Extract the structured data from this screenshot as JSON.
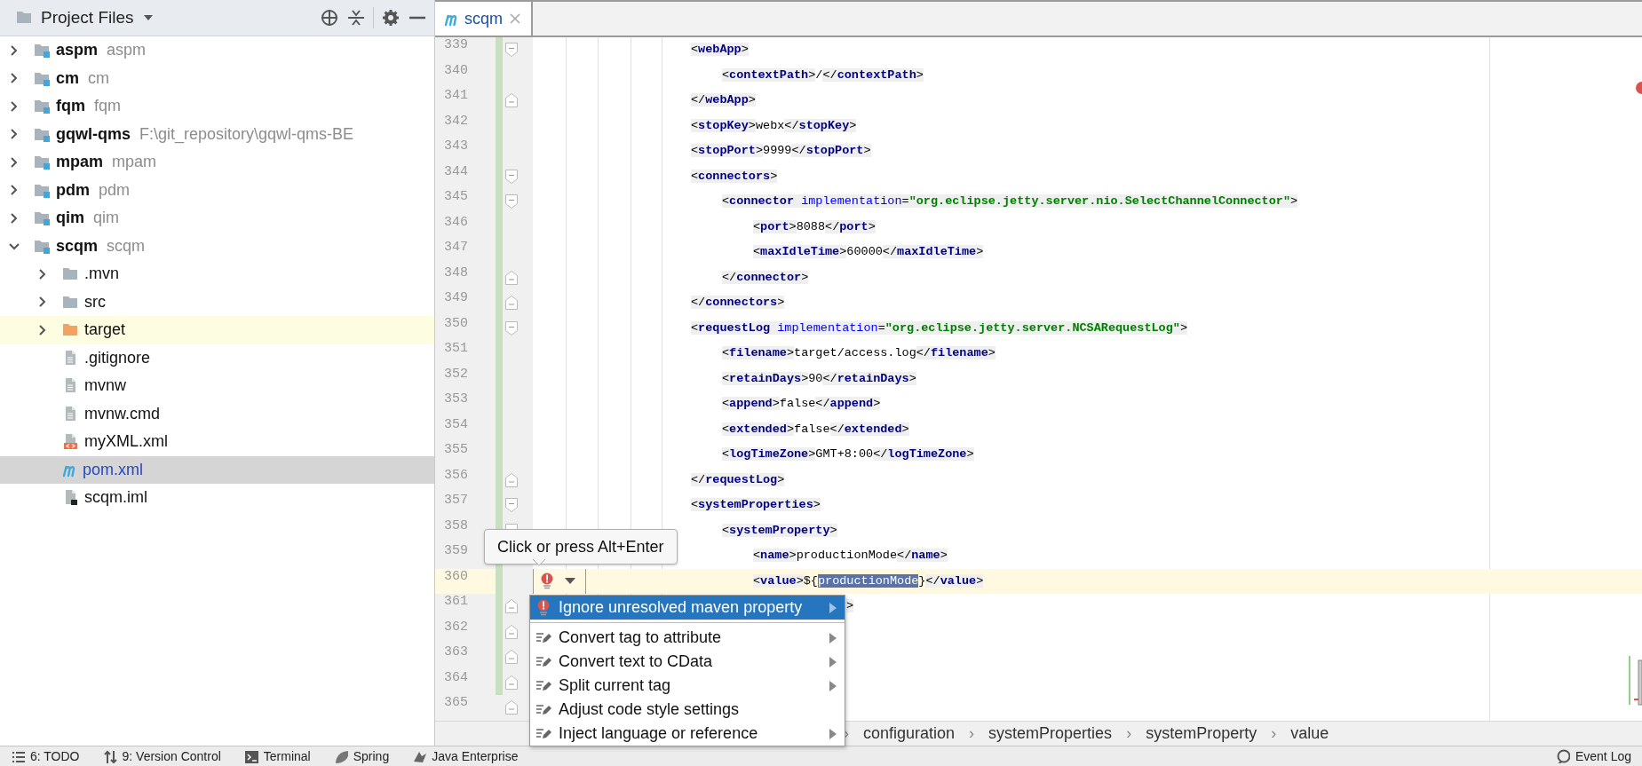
{
  "sidebar": {
    "title": "Project Files",
    "items": [
      {
        "label": "aspm",
        "hint": "aspm",
        "kind": "module",
        "expanded": false,
        "selected": false,
        "highlighted": false,
        "modified": false
      },
      {
        "label": "cm",
        "hint": "cm",
        "kind": "module",
        "expanded": false,
        "selected": false,
        "highlighted": false,
        "modified": false
      },
      {
        "label": "fqm",
        "hint": "fqm",
        "kind": "module",
        "expanded": false,
        "selected": false,
        "highlighted": false,
        "modified": false
      },
      {
        "label": "gqwl-qms",
        "hint": "F:\\git_repository\\gqwl-qms-BE",
        "kind": "module",
        "expanded": false,
        "selected": false,
        "highlighted": false,
        "modified": false
      },
      {
        "label": "mpam",
        "hint": "mpam",
        "kind": "module",
        "expanded": false,
        "selected": false,
        "highlighted": false,
        "modified": false
      },
      {
        "label": "pdm",
        "hint": "pdm",
        "kind": "module",
        "expanded": false,
        "selected": false,
        "highlighted": false,
        "modified": false
      },
      {
        "label": "qim",
        "hint": "qim",
        "kind": "module",
        "expanded": false,
        "selected": false,
        "highlighted": false,
        "modified": false
      },
      {
        "label": "scqm",
        "hint": "scqm",
        "kind": "module",
        "expanded": true,
        "selected": false,
        "highlighted": false,
        "modified": false,
        "children": [
          {
            "label": ".mvn",
            "kind": "folder",
            "expanded": false,
            "selected": false,
            "highlighted": false,
            "modified": false
          },
          {
            "label": "src",
            "kind": "folder",
            "expanded": false,
            "selected": false,
            "highlighted": false,
            "modified": false
          },
          {
            "label": "target",
            "kind": "excluded",
            "expanded": false,
            "selected": false,
            "highlighted": true,
            "modified": false
          },
          {
            "label": ".gitignore",
            "kind": "file",
            "selected": false,
            "highlighted": false,
            "modified": false
          },
          {
            "label": "mvnw",
            "kind": "file",
            "selected": false,
            "highlighted": false,
            "modified": false
          },
          {
            "label": "mvnw.cmd",
            "kind": "file",
            "selected": false,
            "highlighted": false,
            "modified": false
          },
          {
            "label": "myXML.xml",
            "kind": "xml",
            "selected": false,
            "highlighted": false,
            "modified": false
          },
          {
            "label": "pom.xml",
            "kind": "maven",
            "selected": true,
            "highlighted": false,
            "modified": true
          },
          {
            "label": "scqm.iml",
            "kind": "iml",
            "selected": false,
            "highlighted": false,
            "modified": false
          }
        ]
      }
    ]
  },
  "editor": {
    "tabs": [
      {
        "label": "scqm",
        "kind": "maven",
        "selected": true
      }
    ],
    "has_errors": true,
    "lines": [
      {
        "number": "339",
        "changed": true,
        "current": false,
        "fold_start": true,
        "fold_end": false,
        "tokens": [
          {
            "kind": "punct",
            "text": "<"
          },
          {
            "kind": "tag",
            "text": "webApp"
          },
          {
            "kind": "punct",
            "text": ">"
          }
        ],
        "children": [
          {
            "number": "340",
            "changed": true,
            "current": false,
            "fold_start": false,
            "fold_end": false,
            "tokens": [
              {
                "kind": "punct",
                "text": "<"
              },
              {
                "kind": "tag",
                "text": "contextPath"
              },
              {
                "kind": "punct",
                "text": ">"
              },
              {
                "kind": "text",
                "text": "/"
              },
              {
                "kind": "punct",
                "text": "</"
              },
              {
                "kind": "tag",
                "text": "contextPath"
              },
              {
                "kind": "punct",
                "text": ">"
              }
            ]
          }
        ]
      },
      {
        "number": "341",
        "changed": true,
        "current": false,
        "fold_start": false,
        "fold_end": true,
        "tokens": [
          {
            "kind": "punct",
            "text": "</"
          },
          {
            "kind": "tag",
            "text": "webApp"
          },
          {
            "kind": "punct",
            "text": ">"
          }
        ]
      },
      {
        "number": "342",
        "changed": true,
        "current": false,
        "fold_start": false,
        "fold_end": false,
        "tokens": [
          {
            "kind": "punct",
            "text": "<"
          },
          {
            "kind": "tag",
            "text": "stopKey"
          },
          {
            "kind": "punct",
            "text": ">"
          },
          {
            "kind": "text",
            "text": "webx"
          },
          {
            "kind": "punct",
            "text": "</"
          },
          {
            "kind": "tag",
            "text": "stopKey"
          },
          {
            "kind": "punct",
            "text": ">"
          }
        ]
      },
      {
        "number": "343",
        "changed": true,
        "current": false,
        "fold_start": false,
        "fold_end": false,
        "tokens": [
          {
            "kind": "punct",
            "text": "<"
          },
          {
            "kind": "tag",
            "text": "stopPort"
          },
          {
            "kind": "punct",
            "text": ">"
          },
          {
            "kind": "text",
            "text": "9999"
          },
          {
            "kind": "punct",
            "text": "</"
          },
          {
            "kind": "tag",
            "text": "stopPort"
          },
          {
            "kind": "punct",
            "text": ">"
          }
        ]
      },
      {
        "number": "344",
        "changed": true,
        "current": false,
        "fold_start": true,
        "fold_end": false,
        "tokens": [
          {
            "kind": "punct",
            "text": "<"
          },
          {
            "kind": "tag",
            "text": "connectors"
          },
          {
            "kind": "punct",
            "text": ">"
          }
        ],
        "children": [
          {
            "number": "345",
            "changed": true,
            "current": false,
            "fold_start": true,
            "fold_end": false,
            "tokens": [
              {
                "kind": "punct",
                "text": "<"
              },
              {
                "kind": "tag",
                "text": "connector"
              },
              {
                "kind": "attr",
                "text": "implementation"
              },
              {
                "kind": "punct",
                "text": "="
              },
              {
                "kind": "string",
                "text": "\"org.eclipse.jetty.server.nio.SelectChannelConnector\""
              },
              {
                "kind": "punct",
                "text": ">"
              }
            ],
            "children": [
              {
                "number": "346",
                "changed": true,
                "current": false,
                "fold_start": false,
                "fold_end": false,
                "tokens": [
                  {
                    "kind": "punct",
                    "text": "<"
                  },
                  {
                    "kind": "tag",
                    "text": "port"
                  },
                  {
                    "kind": "punct",
                    "text": ">"
                  },
                  {
                    "kind": "text",
                    "text": "8088"
                  },
                  {
                    "kind": "punct",
                    "text": "</"
                  },
                  {
                    "kind": "tag",
                    "text": "port"
                  },
                  {
                    "kind": "punct",
                    "text": ">"
                  }
                ]
              },
              {
                "number": "347",
                "changed": true,
                "current": false,
                "fold_start": false,
                "fold_end": false,
                "tokens": [
                  {
                    "kind": "punct",
                    "text": "<"
                  },
                  {
                    "kind": "tag",
                    "text": "maxIdleTime"
                  },
                  {
                    "kind": "punct",
                    "text": ">"
                  },
                  {
                    "kind": "text",
                    "text": "60000"
                  },
                  {
                    "kind": "punct",
                    "text": "</"
                  },
                  {
                    "kind": "tag",
                    "text": "maxIdleTime"
                  },
                  {
                    "kind": "punct",
                    "text": ">"
                  }
                ]
              }
            ]
          },
          {
            "number": "348",
            "changed": true,
            "current": false,
            "fold_start": false,
            "fold_end": true,
            "tokens": [
              {
                "kind": "punct",
                "text": "</"
              },
              {
                "kind": "tag",
                "text": "connector"
              },
              {
                "kind": "punct",
                "text": ">"
              }
            ]
          }
        ]
      },
      {
        "number": "349",
        "changed": true,
        "current": false,
        "fold_start": false,
        "fold_end": true,
        "tokens": [
          {
            "kind": "punct",
            "text": "</"
          },
          {
            "kind": "tag",
            "text": "connectors"
          },
          {
            "kind": "punct",
            "text": ">"
          }
        ]
      },
      {
        "number": "350",
        "changed": true,
        "current": false,
        "fold_start": true,
        "fold_end": false,
        "tokens": [
          {
            "kind": "punct",
            "text": "<"
          },
          {
            "kind": "tag",
            "text": "requestLog"
          },
          {
            "kind": "attr",
            "text": "implementation"
          },
          {
            "kind": "punct",
            "text": "="
          },
          {
            "kind": "string",
            "text": "\"org.eclipse.jetty.server.NCSARequestLog\""
          },
          {
            "kind": "punct",
            "text": ">"
          }
        ],
        "children": [
          {
            "number": "351",
            "changed": true,
            "current": false,
            "fold_start": false,
            "fold_end": false,
            "tokens": [
              {
                "kind": "punct",
                "text": "<"
              },
              {
                "kind": "tag",
                "text": "filename"
              },
              {
                "kind": "punct",
                "text": ">"
              },
              {
                "kind": "text",
                "text": "target/access.log"
              },
              {
                "kind": "punct",
                "text": "</"
              },
              {
                "kind": "tag",
                "text": "filename"
              },
              {
                "kind": "punct",
                "text": ">"
              }
            ]
          },
          {
            "number": "352",
            "changed": true,
            "current": false,
            "fold_start": false,
            "fold_end": false,
            "tokens": [
              {
                "kind": "punct",
                "text": "<"
              },
              {
                "kind": "tag",
                "text": "retainDays"
              },
              {
                "kind": "punct",
                "text": ">"
              },
              {
                "kind": "text",
                "text": "90"
              },
              {
                "kind": "punct",
                "text": "</"
              },
              {
                "kind": "tag",
                "text": "retainDays"
              },
              {
                "kind": "punct",
                "text": ">"
              }
            ]
          },
          {
            "number": "353",
            "changed": true,
            "current": false,
            "fold_start": false,
            "fold_end": false,
            "tokens": [
              {
                "kind": "punct",
                "text": "<"
              },
              {
                "kind": "tag",
                "text": "append"
              },
              {
                "kind": "punct",
                "text": ">"
              },
              {
                "kind": "text",
                "text": "false"
              },
              {
                "kind": "punct",
                "text": "</"
              },
              {
                "kind": "tag",
                "text": "append"
              },
              {
                "kind": "punct",
                "text": ">"
              }
            ]
          },
          {
            "number": "354",
            "changed": true,
            "current": false,
            "fold_start": false,
            "fold_end": false,
            "tokens": [
              {
                "kind": "punct",
                "text": "<"
              },
              {
                "kind": "tag",
                "text": "extended"
              },
              {
                "kind": "punct",
                "text": ">"
              },
              {
                "kind": "text",
                "text": "false"
              },
              {
                "kind": "punct",
                "text": "</"
              },
              {
                "kind": "tag",
                "text": "extended"
              },
              {
                "kind": "punct",
                "text": ">"
              }
            ]
          },
          {
            "number": "355",
            "changed": true,
            "current": false,
            "fold_start": false,
            "fold_end": false,
            "tokens": [
              {
                "kind": "punct",
                "text": "<"
              },
              {
                "kind": "tag",
                "text": "logTimeZone"
              },
              {
                "kind": "punct",
                "text": ">"
              },
              {
                "kind": "text",
                "text": "GMT+8:00"
              },
              {
                "kind": "punct",
                "text": "</"
              },
              {
                "kind": "tag",
                "text": "logTimeZone"
              },
              {
                "kind": "punct",
                "text": ">"
              }
            ]
          }
        ]
      },
      {
        "number": "356",
        "changed": true,
        "current": false,
        "fold_start": false,
        "fold_end": true,
        "tokens": [
          {
            "kind": "punct",
            "text": "</"
          },
          {
            "kind": "tag",
            "text": "requestLog"
          },
          {
            "kind": "punct",
            "text": ">"
          }
        ]
      },
      {
        "number": "357",
        "changed": true,
        "current": false,
        "fold_start": true,
        "fold_end": false,
        "tokens": [
          {
            "kind": "punct",
            "text": "<"
          },
          {
            "kind": "tag",
            "text": "systemProperties"
          },
          {
            "kind": "punct",
            "text": ">"
          }
        ],
        "children": [
          {
            "number": "358",
            "changed": true,
            "current": false,
            "fold_start": true,
            "fold_end": false,
            "tokens": [
              {
                "kind": "punct",
                "text": "<"
              },
              {
                "kind": "tag",
                "text": "systemProperty"
              },
              {
                "kind": "punct",
                "text": ">"
              }
            ],
            "children": [
              {
                "number": "359",
                "changed": true,
                "current": false,
                "fold_start": false,
                "fold_end": false,
                "tokens": [
                  {
                    "kind": "punct",
                    "text": "<"
                  },
                  {
                    "kind": "tag",
                    "text": "name"
                  },
                  {
                    "kind": "punct",
                    "text": ">"
                  },
                  {
                    "kind": "text",
                    "text": "productionMode"
                  },
                  {
                    "kind": "punct",
                    "text": "</"
                  },
                  {
                    "kind": "tag",
                    "text": "name"
                  },
                  {
                    "kind": "punct",
                    "text": ">"
                  }
                ]
              },
              {
                "number": "360",
                "changed": true,
                "current": true,
                "fold_start": false,
                "fold_end": false,
                "tokens": [
                  {
                    "kind": "punct",
                    "text": "<"
                  },
                  {
                    "kind": "tag",
                    "text": "value"
                  },
                  {
                    "kind": "punct",
                    "text": ">"
                  },
                  {
                    "kind": "text",
                    "text": "${"
                  },
                  {
                    "kind": "selection",
                    "text": "productionMode"
                  },
                  {
                    "kind": "text",
                    "text": "}"
                  },
                  {
                    "kind": "punct",
                    "text": "</"
                  },
                  {
                    "kind": "tag",
                    "text": "value"
                  },
                  {
                    "kind": "punct",
                    "text": ">"
                  }
                ]
              }
            ]
          },
          {
            "number": "361",
            "changed": true,
            "current": false,
            "fold_start": false,
            "fold_end": true,
            "covered": true,
            "tokens": [
              {
                "kind": "punct",
                "text": ">"
              }
            ]
          }
        ]
      },
      {
        "number": "362",
        "changed": true,
        "current": false,
        "fold_start": false,
        "fold_end": true
      },
      {
        "number": "363",
        "changed": true,
        "current": false,
        "fold_start": false,
        "fold_end": true
      },
      {
        "number": "364",
        "changed": true,
        "current": false,
        "fold_start": false,
        "fold_end": true
      },
      {
        "number": "365",
        "changed": false,
        "current": false,
        "fold_start": false,
        "fold_end": true
      }
    ],
    "breadcrumbs": [
      {
        "kind": "separator",
        "text": "›"
      },
      {
        "kind": "crumb",
        "text": "configuration"
      },
      {
        "kind": "separator",
        "text": "›"
      },
      {
        "kind": "crumb",
        "text": "systemProperties"
      },
      {
        "kind": "separator",
        "text": "›"
      },
      {
        "kind": "crumb",
        "text": "systemProperty"
      },
      {
        "kind": "separator",
        "text": "›"
      },
      {
        "kind": "crumb",
        "text": "value"
      }
    ]
  },
  "quick_fix": {
    "kind": "error",
    "tooltip": "Click or press Alt+Enter",
    "items": [
      {
        "kind": "quickfix",
        "label": "Ignore unresolved maven property",
        "selected": true,
        "submenu": true
      },
      {
        "kind": "intention",
        "label": "Convert tag to attribute",
        "selected": false,
        "submenu": true
      },
      {
        "kind": "intention",
        "label": "Convert text to CData",
        "selected": false,
        "submenu": true
      },
      {
        "kind": "intention",
        "label": "Split current tag",
        "selected": false,
        "submenu": true
      },
      {
        "kind": "intention",
        "label": "Adjust code style settings",
        "selected": false,
        "submenu": false
      },
      {
        "kind": "intention",
        "label": "Inject language or reference",
        "selected": false,
        "submenu": true
      }
    ]
  },
  "tool_windows": [
    {
      "kind": "todo",
      "label": "6: TODO"
    },
    {
      "kind": "vcs",
      "label": "9: Version Control"
    },
    {
      "kind": "terminal",
      "label": "Terminal"
    },
    {
      "kind": "spring",
      "label": "Spring"
    },
    {
      "kind": "enterprise",
      "label": "Java Enterprise"
    },
    {
      "kind": "log",
      "label": "Event Log"
    }
  ]
}
